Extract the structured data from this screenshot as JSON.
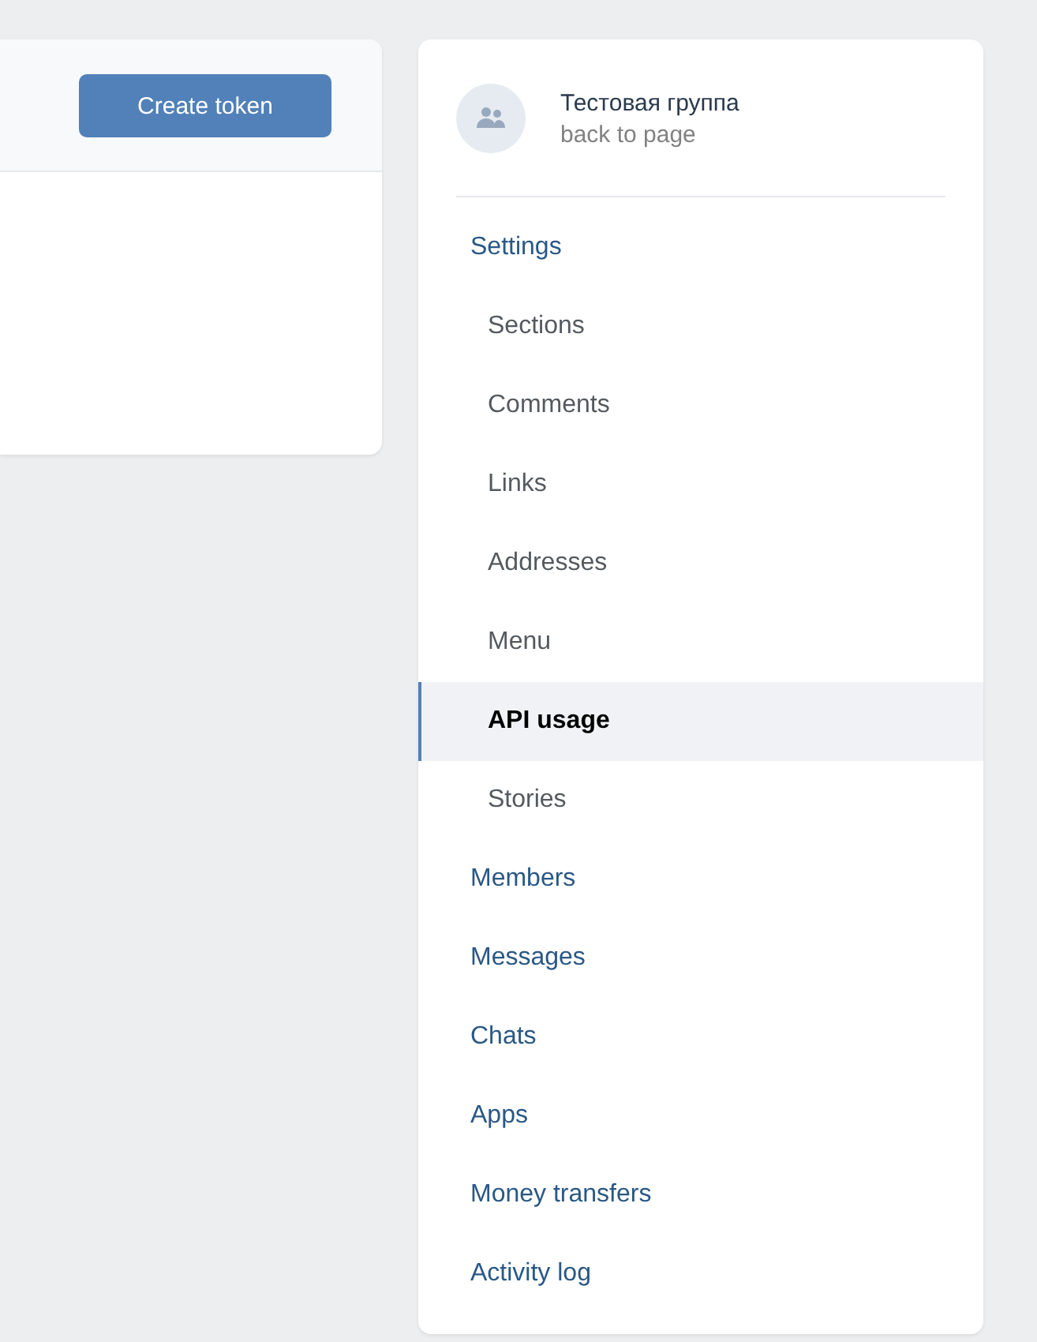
{
  "toolbar": {
    "create_button": "Create token"
  },
  "group": {
    "name": "Тестовая группа",
    "back_link": "back to page"
  },
  "menu": [
    {
      "label": "Settings",
      "selected": false,
      "children": [
        {
          "label": "Sections",
          "selected": false
        },
        {
          "label": "Comments",
          "selected": false
        },
        {
          "label": "Links",
          "selected": false
        },
        {
          "label": "Addresses",
          "selected": false
        },
        {
          "label": "Menu",
          "selected": false
        },
        {
          "label": "API usage",
          "selected": true
        },
        {
          "label": "Stories",
          "selected": false
        }
      ]
    },
    {
      "label": "Members",
      "selected": false
    },
    {
      "label": "Messages",
      "selected": false
    },
    {
      "label": "Chats",
      "selected": false
    },
    {
      "label": "Apps",
      "selected": false
    },
    {
      "label": "Money transfers",
      "selected": false
    },
    {
      "label": "Activity log",
      "selected": false
    }
  ]
}
